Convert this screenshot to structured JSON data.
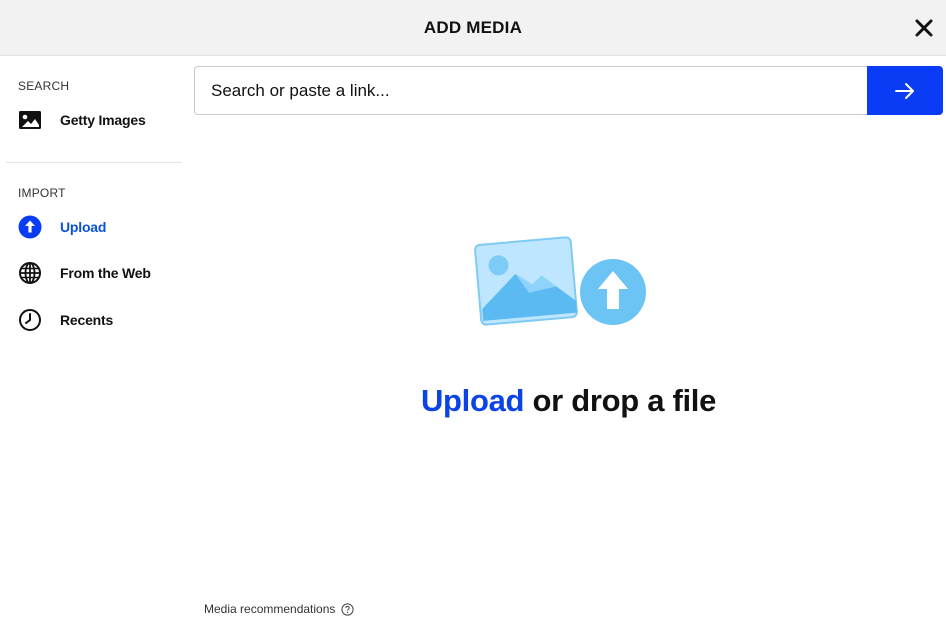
{
  "header": {
    "title": "ADD MEDIA",
    "close_icon": "close-icon"
  },
  "sidebar": {
    "search_section": {
      "label": "SEARCH",
      "items": [
        {
          "label": "Getty Images",
          "icon": "image-icon"
        }
      ]
    },
    "import_section": {
      "label": "IMPORT",
      "items": [
        {
          "label": "Upload",
          "icon": "upload-icon",
          "active": true
        },
        {
          "label": "From the Web",
          "icon": "globe-icon"
        },
        {
          "label": "Recents",
          "icon": "clock-icon"
        }
      ]
    }
  },
  "search": {
    "placeholder": "Search or paste a link...",
    "value": "",
    "submit_icon": "arrow-right-icon"
  },
  "drop_area": {
    "upload_link": "Upload",
    "rest_text": " or drop a file"
  },
  "footer": {
    "recommendations_label": "Media recommendations",
    "help_icon": "help-icon"
  },
  "colors": {
    "accent": "#0a3cf5",
    "active_text": "#0a53d6",
    "header_bg": "#f2f2f2"
  }
}
